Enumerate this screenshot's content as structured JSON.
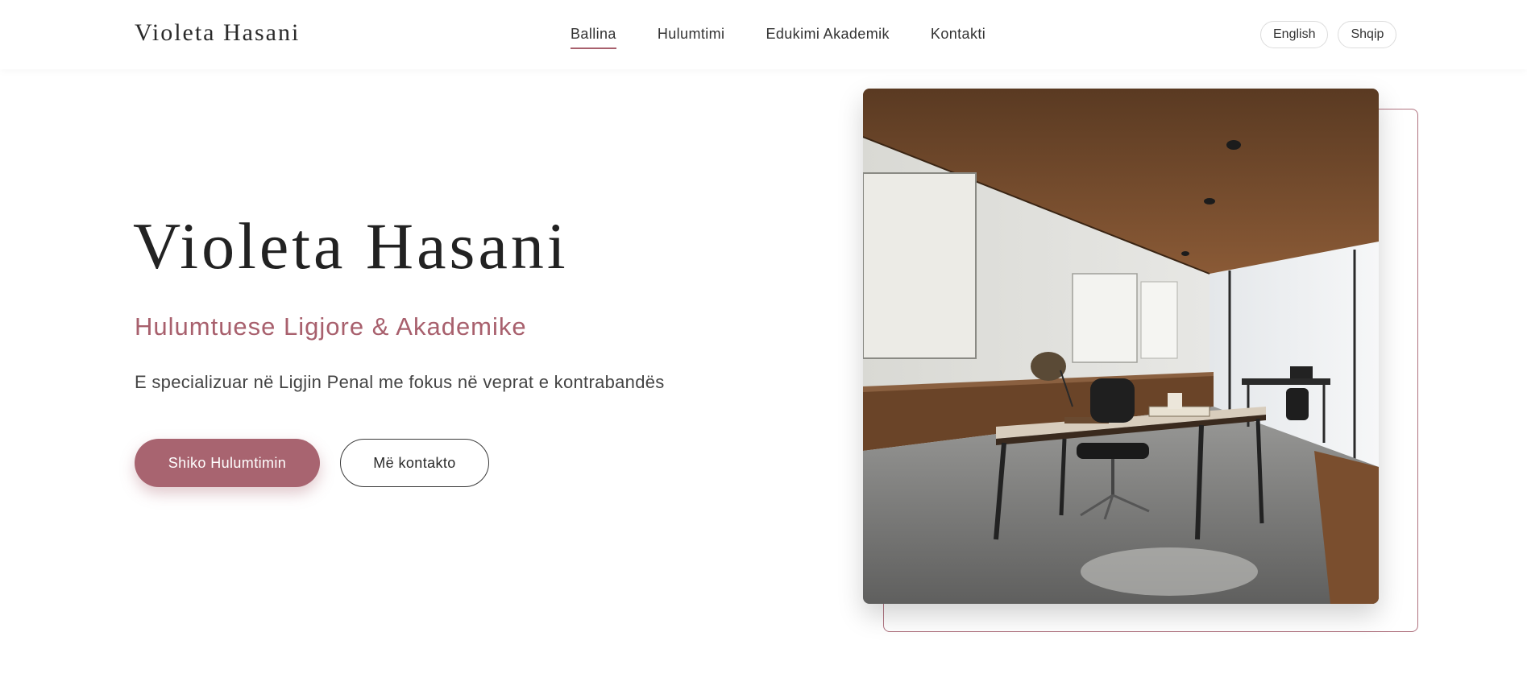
{
  "header": {
    "brand": "Violeta Hasani",
    "nav": [
      {
        "label": "Ballina",
        "active": true
      },
      {
        "label": "Hulumtimi",
        "active": false
      },
      {
        "label": "Edukimi Akademik",
        "active": false
      },
      {
        "label": "Kontakti",
        "active": false
      }
    ],
    "languages": [
      "English",
      "Shqip"
    ]
  },
  "hero": {
    "name": "Violeta Hasani",
    "role": "Hulumtuese Ligjore & Akademike",
    "description": "E specializuar në Ligjin Penal me fokus në veprat e kontrabandës",
    "primary_button": "Shiko Hulumtimin",
    "secondary_button": "Më kontakto"
  },
  "colors": {
    "accent": "#a8606d",
    "text": "#2a2a2a",
    "background": "#ffffff"
  }
}
